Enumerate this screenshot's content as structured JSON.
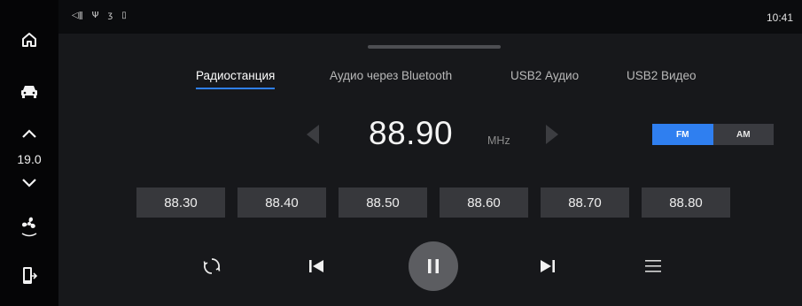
{
  "sidebar": {
    "temperature": "19.0",
    "icons": [
      "home-icon",
      "car-icon",
      "chevron-up-icon",
      "chevron-down-icon",
      "fan-icon",
      "phone-exit-icon"
    ]
  },
  "status": {
    "clock": "10:41",
    "icons": [
      "volume-icon",
      "usb-icon",
      "bluetooth-icon",
      "phone-icon"
    ]
  },
  "tabs": [
    {
      "label": "Радиостанция",
      "active": true
    },
    {
      "label": "Аудио через Bluetooth",
      "active": false
    },
    {
      "label": "USB2 Аудио",
      "active": false
    },
    {
      "label": "USB2 Видео",
      "active": false
    }
  ],
  "tuner": {
    "frequency": "88.90",
    "unit": "MHz",
    "band_fm": "FM",
    "band_am": "AM",
    "active_band": "FM"
  },
  "presets": [
    "88.30",
    "88.40",
    "88.50",
    "88.60",
    "88.70",
    "88.80"
  ],
  "controls": [
    "refresh-icon",
    "previous-icon",
    "pause-icon",
    "next-icon",
    "list-icon"
  ],
  "colors": {
    "accent": "#2f7ff0",
    "background": "#17181b",
    "preset_bg": "#37383c"
  }
}
